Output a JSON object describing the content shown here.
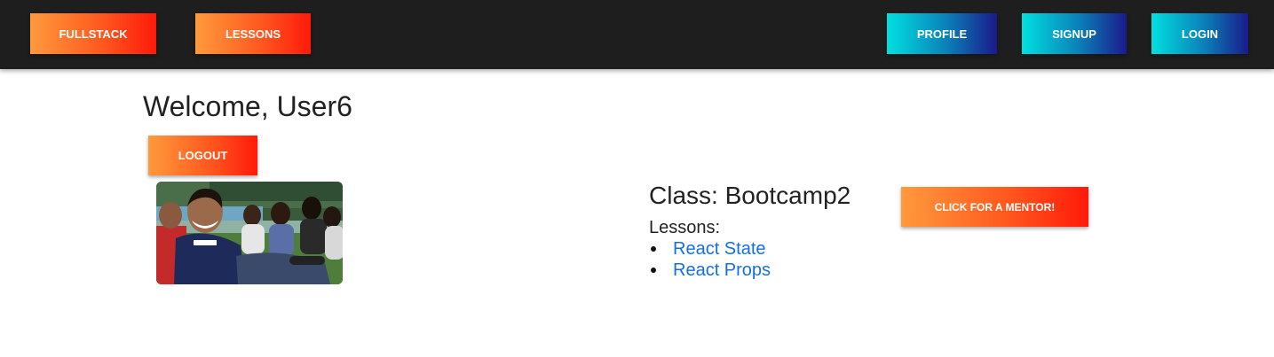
{
  "navbar": {
    "left": [
      {
        "label": "FULLSTACK",
        "name": "fullstack-button"
      },
      {
        "label": "LESSONS",
        "name": "lessons-button"
      }
    ],
    "right": [
      {
        "label": "PROFILE",
        "name": "profile-button"
      },
      {
        "label": "SIGNUP",
        "name": "signup-button"
      },
      {
        "label": "LOGIN",
        "name": "login-button"
      }
    ]
  },
  "main": {
    "welcome": "Welcome, User6",
    "logout_label": "LOGOUT",
    "class_title": "Class: Bootcamp2",
    "lessons_label": "Lessons:",
    "lessons": [
      "React State",
      "React Props"
    ],
    "mentor_label": "CLICK FOR A MENTOR!"
  },
  "colors": {
    "navbar_bg": "#1e1e1e",
    "warm_gradient": [
      "#ff9a3c",
      "#ff1a0a"
    ],
    "cool_gradient": [
      "#00e0e0",
      "#1a1a8a"
    ],
    "link": "#1470e0",
    "text": "#222222"
  },
  "icons": {
    "photo": "students-group-photo"
  }
}
